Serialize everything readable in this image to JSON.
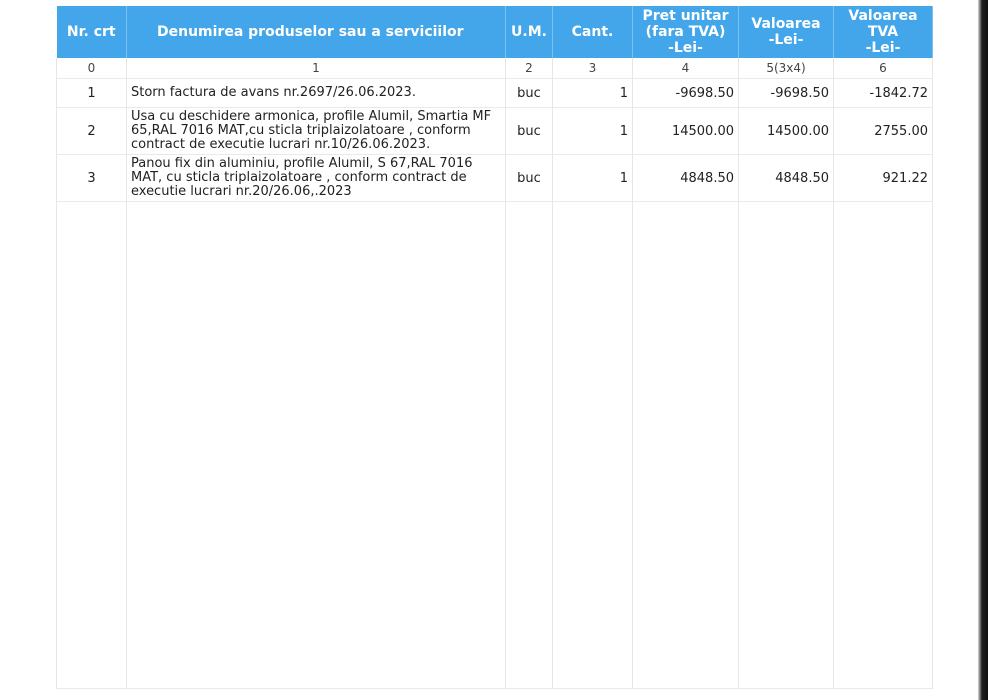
{
  "headers": {
    "nr": "Nr. crt",
    "denumire": "Denumirea produselor sau a serviciilor",
    "um": "U.M.",
    "cant": "Cant.",
    "pret_line1": "Pret unitar",
    "pret_line2": "(fara TVA)",
    "pret_line3": "-Lei-",
    "valoare_line1": "Valoarea",
    "valoare_line2": "-Lei-",
    "tva_line1": "Valoarea",
    "tva_line2": "TVA",
    "tva_line3": "-Lei-"
  },
  "index_row": [
    "0",
    "1",
    "2",
    "3",
    "4",
    "5(3x4)",
    "6"
  ],
  "items": [
    {
      "nr": "1",
      "denumire_lines": [
        "Storn factura de avans nr.2697/26.06.2023."
      ],
      "um": "buc",
      "cant": "1",
      "pret": "-9698.50",
      "valoare": "-9698.50",
      "tva": "-1842.72"
    },
    {
      "nr": "2",
      "denumire_lines": [
        "Usa cu deschidere armonica, profile Alumil, Smartia MF",
        "65,RAL 7016 MAT,cu sticla triplaizolatoare , conform",
        "contract de executie lucrari nr.10/26.06.2023."
      ],
      "um": "buc",
      "cant": "1",
      "pret": "14500.00",
      "valoare": "14500.00",
      "tva": "2755.00"
    },
    {
      "nr": "3",
      "denumire_lines": [
        "Panou fix din aluminiu, profile Alumil, S 67,RAL 7016",
        "MAT, cu sticla triplaizolatoare , conform contract de",
        "executie lucrari nr.20/26.06,.2023"
      ],
      "um": "buc",
      "cant": "1",
      "pret": "4848.50",
      "valoare": "4848.50",
      "tva": "921.22"
    }
  ]
}
